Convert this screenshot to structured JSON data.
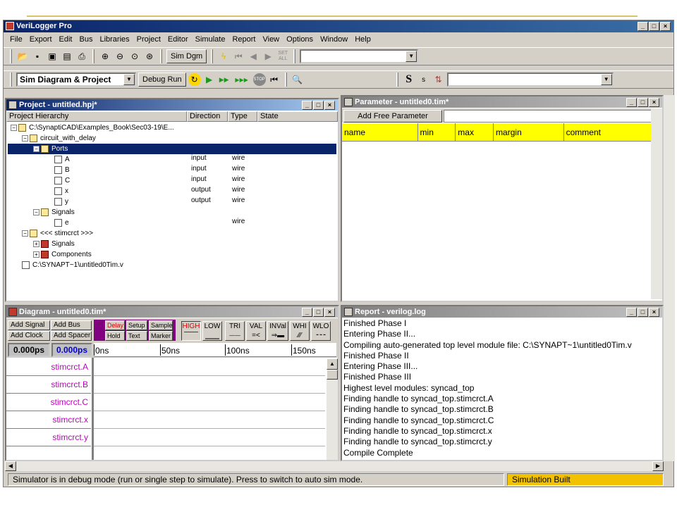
{
  "app": {
    "title": "VeriLogger Pro"
  },
  "menu": [
    "File",
    "Export",
    "Edit",
    "Bus",
    "Libraries",
    "Project",
    "Editor",
    "Simulate",
    "Report",
    "View",
    "Options",
    "Window",
    "Help"
  ],
  "toolbar1": {
    "sim_dgm_label": "Sim Dgm",
    "set_all_label": "SET ALL"
  },
  "toolbar2": {
    "mode_value": "Sim Diagram & Project",
    "debug_run_label": "Debug Run",
    "s_big": "S",
    "s_small": "s"
  },
  "project": {
    "title": "Project - untitled.hpj*",
    "columns": [
      "Project Hierarchy",
      "Direction",
      "Type",
      "State"
    ],
    "rows": [
      {
        "label": "C:\\SynaptiCAD\\Examples_Book\\Sec03-19\\E...",
        "dir": "",
        "type": ""
      },
      {
        "label": "circuit_with_delay",
        "dir": "",
        "type": ""
      },
      {
        "label": "Ports",
        "dir": "",
        "type": ""
      },
      {
        "label": "A",
        "dir": "input",
        "type": "wire"
      },
      {
        "label": "B",
        "dir": "input",
        "type": "wire"
      },
      {
        "label": "C",
        "dir": "input",
        "type": "wire"
      },
      {
        "label": "x",
        "dir": "output",
        "type": "wire"
      },
      {
        "label": "y",
        "dir": "output",
        "type": "wire"
      },
      {
        "label": "Signals",
        "dir": "",
        "type": ""
      },
      {
        "label": "e",
        "dir": "",
        "type": "wire"
      },
      {
        "label": "<<< stimcrct >>>",
        "dir": "",
        "type": ""
      },
      {
        "label": "Signals",
        "dir": "",
        "type": ""
      },
      {
        "label": "Components",
        "dir": "",
        "type": ""
      },
      {
        "label": "C:\\SYNAPT~1\\untitled0Tim.v",
        "dir": "",
        "type": ""
      }
    ]
  },
  "parameter": {
    "title": "Parameter - untitled0.tim*",
    "add_label": "Add Free Parameter",
    "columns": [
      "name",
      "min",
      "max",
      "margin",
      "comment"
    ]
  },
  "diagram": {
    "title": "Diagram - untitled0.tim*",
    "buttons": [
      "Add Signal",
      "Add Bus",
      "Add Clock",
      "Add Spacer"
    ],
    "red_buttons": [
      "Delay",
      "Setup",
      "Sample",
      "Hold",
      "Text",
      "Marker"
    ],
    "wave_buttons": [
      "HIGH",
      "LOW",
      "TRI",
      "VAL",
      "INVal",
      "WHI",
      "WLO"
    ],
    "time1": "0.000ps",
    "time2": "0.000ps",
    "ticks": [
      "0ns",
      "50ns",
      "100ns",
      "150ns"
    ],
    "signals": [
      "stimcrct.A",
      "stimcrct.B",
      "stimcrct.C",
      "stimcrct.x",
      "stimcrct.y"
    ]
  },
  "report": {
    "title": "Report - verilog.log",
    "lines": [
      "Finished Phase I",
      "Entering Phase II...",
      "Compiling auto-generated top level module file: C:\\SYNAPT~1\\untitled0Tim.v",
      "Finished Phase II",
      "Entering Phase III...",
      "Finished Phase III",
      "Highest level modules:   syncad_top",
      "Finding handle to syncad_top.stimcrct.A",
      "Finding handle to syncad_top.stimcrct.B",
      "Finding handle to syncad_top.stimcrct.C",
      "Finding handle to syncad_top.stimcrct.x",
      "Finding handle to syncad_top.stimcrct.y",
      "Compile Complete"
    ]
  },
  "status": {
    "message": "Simulator is in debug mode (run or single step to simulate). Press to switch to auto sim mode.",
    "state": "Simulation Built",
    "state_color": "#f2c200"
  }
}
